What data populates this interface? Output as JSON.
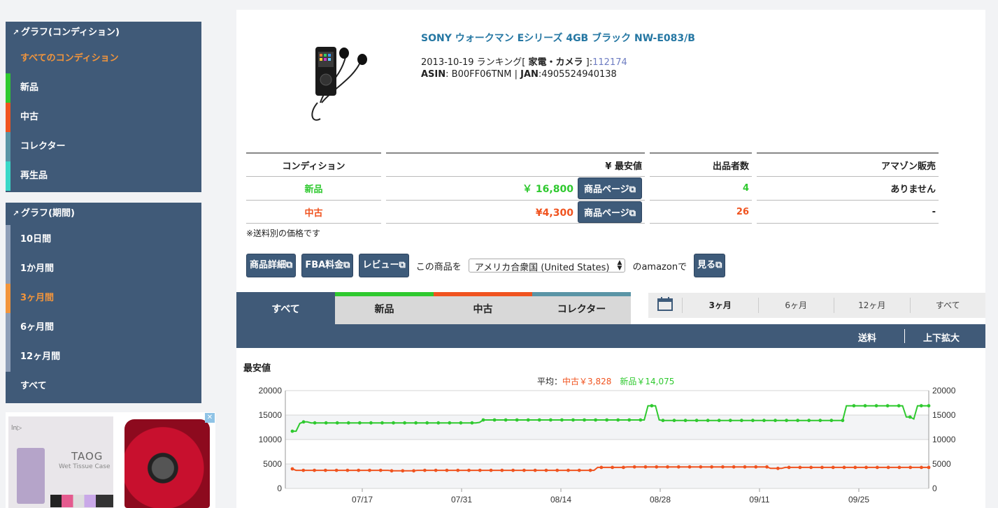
{
  "sidebar": {
    "condition": {
      "heading": "グラフ(コンディション)",
      "items": [
        {
          "label": "すべてのコンディション",
          "active": true,
          "color": ""
        },
        {
          "label": "新品",
          "color": "#2fc92f"
        },
        {
          "label": "中古",
          "color": "#f0531f"
        },
        {
          "label": "コレクター",
          "color": "#5a95a6"
        },
        {
          "label": "再生品",
          "color": "#3ad8c8"
        }
      ]
    },
    "period": {
      "heading": "グラフ(期間)",
      "items": [
        {
          "label": "10日間"
        },
        {
          "label": "1か月間"
        },
        {
          "label": "3ヶ月間",
          "active": true
        },
        {
          "label": "6ヶ月間"
        },
        {
          "label": "12ヶ月間"
        },
        {
          "label": "すべて"
        }
      ]
    }
  },
  "ad": {
    "brand": "ln▷",
    "title": "TAOG",
    "subtitle": "Wet Tissue Case",
    "close": "✕"
  },
  "product": {
    "title": "SONY ウォークマン Eシリーズ 4GB ブラック NW-E083/B",
    "rank_prefix": "2013-10-19 ランキング[",
    "rank_category": "家電・カメラ",
    "rank_suffix": "]:",
    "rank_value": "112174",
    "asin_label": "ASIN",
    "asin": ": B00FF06TNM | ",
    "jan_label": "JAN",
    "jan": ":4905524940138"
  },
  "conditions_table": {
    "headers": [
      "コンディション",
      "¥ 最安値",
      "出品者数",
      "アマゾン販売"
    ],
    "rows": [
      {
        "condition": "新品",
        "price": "￥ 16,800",
        "button": "商品ページ",
        "sellers": "4",
        "amazon": "ありません",
        "color": "green"
      },
      {
        "condition": "中古",
        "price": "¥4,300",
        "button": "商品ページ",
        "sellers": "26",
        "amazon": "-",
        "color": "orange"
      }
    ],
    "note": "※送料別の価格です"
  },
  "toolbar": {
    "details": "商品詳細",
    "fba": "FBA料金",
    "review": "レビュー",
    "text1": "この商品を",
    "country": "アメリカ合衆国 (United States)",
    "text2": "のamazonで",
    "view": "見る"
  },
  "tabs": [
    {
      "label": "すべて",
      "active": true,
      "color": ""
    },
    {
      "label": "新品",
      "color": "#2fc92f"
    },
    {
      "label": "中古",
      "color": "#f0531f"
    },
    {
      "label": "コレクター",
      "color": "#5a95a6"
    }
  ],
  "period_tabs": [
    {
      "label": "3ヶ月",
      "active": true
    },
    {
      "label": "6ヶ月"
    },
    {
      "label": "12ヶ月"
    },
    {
      "label": "すべて"
    }
  ],
  "subbar": {
    "shipping": "送料",
    "zoom": "上下拡大"
  },
  "chart": {
    "title": "最安値",
    "avg_label": "平均：",
    "avg_used": "中古￥3,828",
    "avg_new": "新品￥14,075"
  },
  "chart_data": {
    "type": "line",
    "ylim": [
      0,
      20000
    ],
    "yticks": [
      0,
      5000,
      10000,
      15000,
      20000
    ],
    "xticks": [
      "07/17",
      "07/31",
      "08/14",
      "08/28",
      "09/11",
      "09/25"
    ],
    "grid": true,
    "series": [
      {
        "name": "新品",
        "color": "#2fc92f",
        "values": [
          11700,
          11700,
          13300,
          13600,
          13600,
          13400,
          13400,
          13400,
          13400,
          13400,
          13400,
          13400,
          13400,
          13400,
          13400,
          13400,
          13400,
          13400,
          13400,
          13400,
          13400,
          13400,
          13400,
          13400,
          13400,
          13400,
          13400,
          13400,
          13400,
          13400,
          13400,
          13400,
          13400,
          13400,
          13400,
          13400,
          13400,
          13400,
          13400,
          13400,
          13400,
          13400,
          13400,
          13400,
          13400,
          13400,
          13400,
          13400,
          13400,
          13400,
          13500,
          14000,
          14000,
          14000,
          14000,
          14000,
          14000,
          14000,
          14000,
          14000,
          14000,
          14000,
          14000,
          14000,
          14000,
          14000,
          14000,
          14000,
          14000,
          14000,
          14000,
          14000,
          14000,
          14000,
          14000,
          14000,
          14000,
          14000,
          14000,
          14000,
          14000,
          14000,
          14000,
          14000,
          14000,
          14000,
          14000,
          14000,
          14000,
          14000,
          14000,
          14000,
          14000,
          14000,
          14000,
          16900,
          16900,
          16900,
          14000,
          13900,
          13900,
          13900,
          13900,
          13900,
          13900,
          13900,
          13900,
          13900,
          13900,
          13900,
          13900,
          13900,
          13900,
          13900,
          13900,
          13900,
          13900,
          13900,
          13900,
          13900,
          13900,
          13900,
          13900,
          13900,
          13900,
          13900,
          13900,
          13900,
          13900,
          13900,
          13900,
          13900,
          13900,
          13900,
          13900,
          13900,
          13900,
          13900,
          13900,
          13900,
          13900,
          13900,
          13900,
          13900,
          13900,
          13900,
          13900,
          13900,
          16900,
          16900,
          16900,
          16900,
          16900,
          16900,
          16900,
          16900,
          16900,
          16900,
          16900,
          16900,
          16900,
          16900,
          16900,
          16900,
          14600,
          14600,
          14200,
          16900,
          16900,
          16900,
          16900
        ]
      },
      {
        "name": "中古",
        "color": "#f0531f",
        "values": [
          4000,
          3700,
          3700,
          3700,
          3700,
          3700,
          3700,
          3700,
          3700,
          3700,
          3700,
          3700,
          3700,
          3700,
          3700,
          3700,
          3700,
          3700,
          3700,
          3700,
          3700,
          3700,
          3700,
          3700,
          3700,
          3700,
          3700,
          3600,
          3600,
          3600,
          3600,
          3600,
          3600,
          3600,
          3700,
          3700,
          3700,
          3700,
          3700,
          3700,
          3700,
          3700,
          3700,
          3700,
          3700,
          3700,
          3700,
          3700,
          3700,
          3700,
          3700,
          3700,
          3700,
          3700,
          3700,
          3700,
          3700,
          3700,
          3700,
          3700,
          3700,
          3700,
          3700,
          3700,
          3700,
          3700,
          3700,
          3700,
          3700,
          3700,
          3700,
          3700,
          3700,
          3700,
          3700,
          3700,
          3700,
          3700,
          3700,
          3700,
          3700,
          3700,
          3700,
          4300,
          4300,
          4300,
          4300,
          4300,
          4300,
          4300,
          4300,
          4400,
          4400,
          4400,
          4400,
          4400,
          4400,
          4400,
          4400,
          4400,
          4400,
          4400,
          4400,
          4400,
          4400,
          4400,
          4400,
          4400,
          4400,
          4400,
          4400,
          4400,
          4400,
          4400,
          4400,
          4400,
          4400,
          4400,
          4400,
          4400,
          4400,
          4400,
          4400,
          4400,
          4400,
          4400,
          4400,
          4400,
          4400,
          4400,
          4100,
          4100,
          4100,
          4100,
          4300,
          4300,
          4300,
          4300,
          4300,
          4300,
          4300,
          4300,
          4300,
          4300,
          4300,
          4300,
          4300,
          4300,
          4300,
          4300,
          4300,
          4300,
          4300,
          4300,
          4300,
          4300,
          4300,
          4300,
          4300,
          4300,
          4300,
          4300,
          4300,
          4300,
          4300,
          4300,
          4300,
          4300,
          4300,
          4300,
          4300,
          4300,
          4300,
          4300
        ]
      }
    ]
  }
}
